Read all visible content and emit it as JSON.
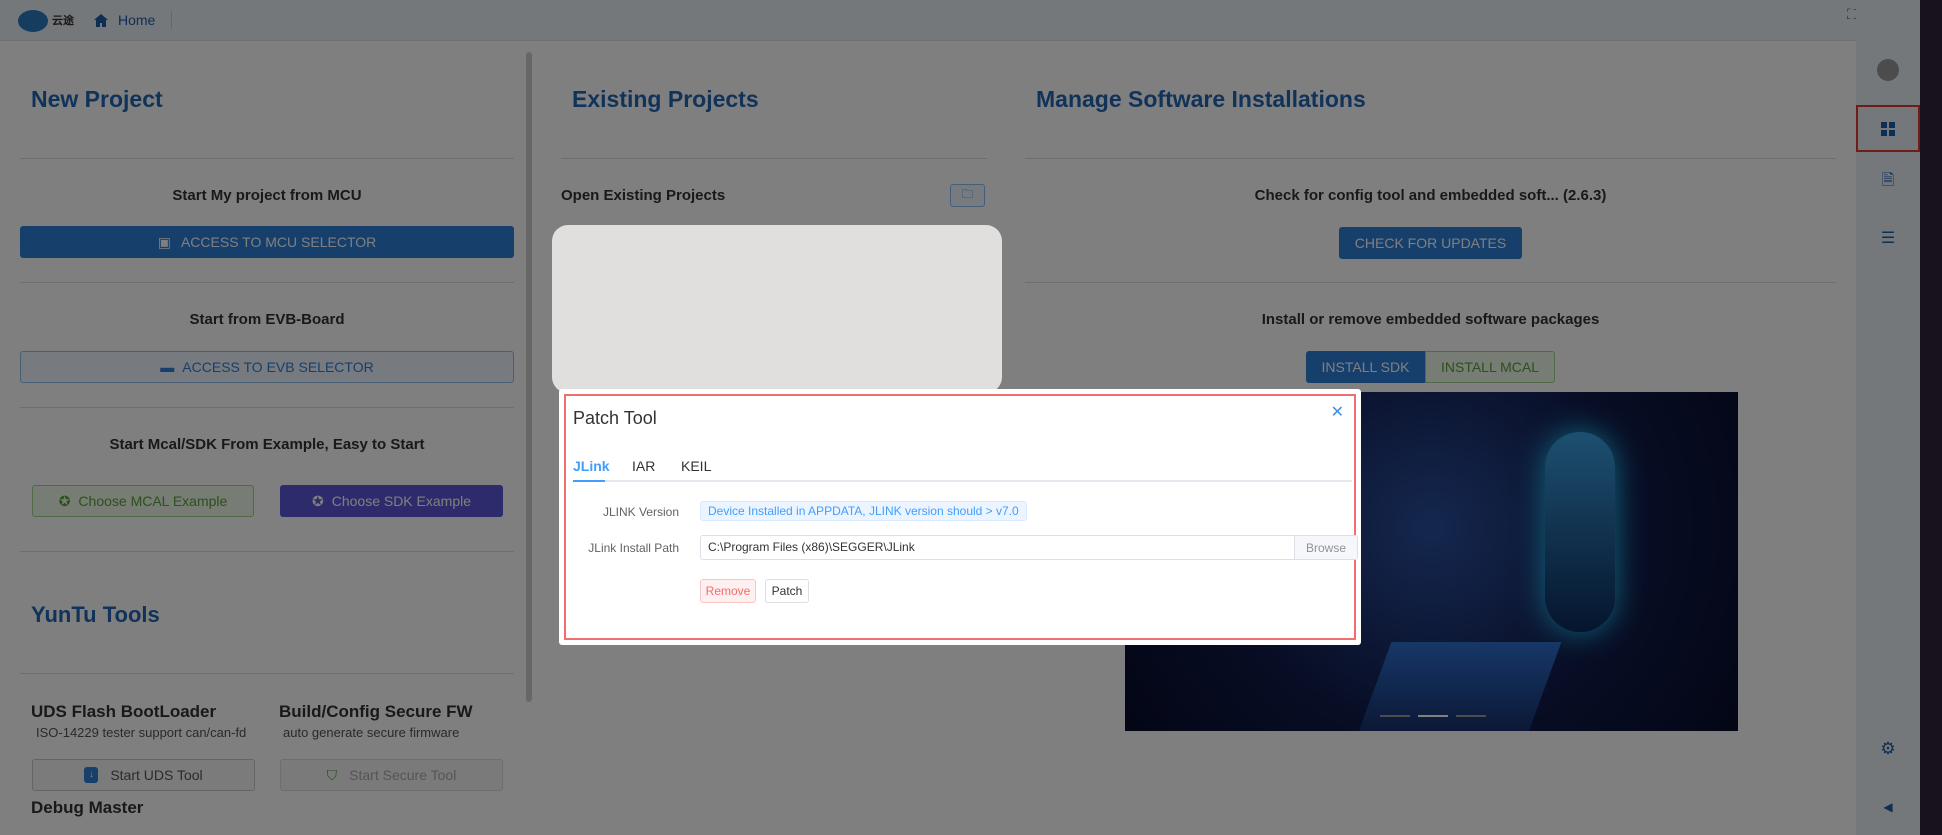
{
  "topbar": {
    "home_label": "Home",
    "logo_text": "云途"
  },
  "new_project": {
    "title": "New Project",
    "mcu_heading": "Start My project from MCU",
    "mcu_button": "ACCESS TO MCU SELECTOR",
    "evb_heading": "Start from EVB-Board",
    "evb_button": "ACCESS TO EVB SELECTOR",
    "example_heading": "Start Mcal/SDK From Example, Easy to Start",
    "mcal_example_button": "Choose MCAL Example",
    "sdk_example_button": "Choose SDK Example"
  },
  "tools": {
    "title": "YunTu Tools",
    "uds": {
      "title": "UDS Flash BootLoader",
      "subtitle": "ISO-14229 tester support can/can-fd",
      "button": "Start UDS Tool"
    },
    "secure": {
      "title": "Build/Config Secure FW",
      "subtitle": "auto generate secure firmware",
      "button": "Start Secure Tool"
    },
    "debug": {
      "title": "Debug Master"
    }
  },
  "existing": {
    "title": "Existing Projects",
    "open_label": "Open Existing Projects"
  },
  "manage": {
    "title": "Manage Software Installations",
    "check_text": "Check for config tool and embedded soft... (2.6.3)",
    "check_button": "CHECK FOR UPDATES",
    "install_text": "Install or remove embedded software packages",
    "install_sdk": "INSTALL SDK",
    "install_mcal": "INSTALL MCAL"
  },
  "dialog": {
    "title": "Patch Tool",
    "tabs": [
      {
        "label": "JLink",
        "active": true
      },
      {
        "label": "IAR"
      },
      {
        "label": "KEIL"
      }
    ],
    "version_label": "JLINK Version",
    "version_tag": "Device Installed in APPDATA, JLINK version should > v7.0",
    "path_label": "JLink Install Path",
    "path_value": "C:\\Program Files (x86)\\SEGGER\\JLink",
    "browse": "Browse",
    "remove": "Remove",
    "patch": "Patch"
  },
  "colors": {
    "accent": "#2367b4",
    "primary": "#2f7fd8",
    "danger": "#f56c6c",
    "highlight_border": "#e53935"
  }
}
